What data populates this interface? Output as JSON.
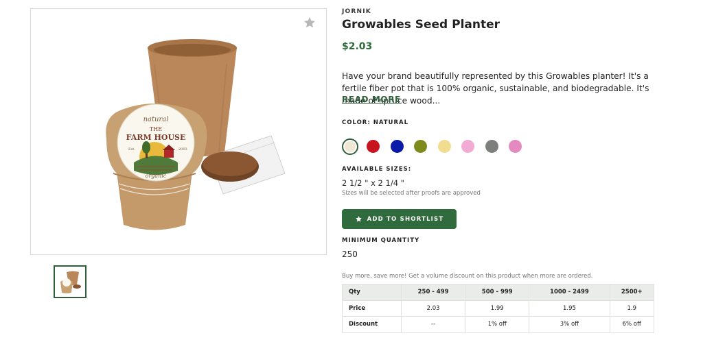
{
  "product": {
    "brand": "JORNIK",
    "title": "Growables Seed Planter",
    "price": "$2.03",
    "description": "Have your brand beautifully represented by this Growables planter! It's a fertile fiber pot that is 100% organic, sustainable, and biodegradable. It's made of spruce wood...",
    "read_more": "READ MORE"
  },
  "image": {
    "label_text": [
      "natural",
      "THE",
      "FARM HOUSE",
      "Est.",
      "2003",
      "organic"
    ]
  },
  "colors": {
    "label": "COLOR: NATURAL",
    "swatches": [
      {
        "name": "natural",
        "hex": "#efe7d3",
        "selected": true
      },
      {
        "name": "red",
        "hex": "#c8141f",
        "selected": false
      },
      {
        "name": "blue",
        "hex": "#0b1aa8",
        "selected": false
      },
      {
        "name": "olive",
        "hex": "#7e8a1c",
        "selected": false
      },
      {
        "name": "yellow",
        "hex": "#f1dc8f",
        "selected": false
      },
      {
        "name": "pink",
        "hex": "#f2acd4",
        "selected": false
      },
      {
        "name": "gray",
        "hex": "#7c7f7c",
        "selected": false
      },
      {
        "name": "magenta",
        "hex": "#e48ac0",
        "selected": false
      }
    ]
  },
  "sizes": {
    "label": "AVAILABLE SIZES:",
    "value": "2 1/2 \" x 2 1/4 \"",
    "note": "Sizes will be selected after proofs are approved"
  },
  "shortlist": {
    "label": "ADD TO SHORTLIST",
    "icon": "star-icon"
  },
  "minimum": {
    "label": "MINIMUM QUANTITY",
    "value": "250"
  },
  "pricing": {
    "note": "Buy more, save more! Get a volume discount on this product when more are ordered.",
    "rows": [
      [
        "Qty",
        "250 - 499",
        "500 - 999",
        "1000 - 2499",
        "2500+"
      ],
      [
        "Price",
        "2.03",
        "1.99",
        "1.95",
        "1.9"
      ],
      [
        "Discount",
        "--",
        "1% off",
        "3% off",
        "6% off"
      ]
    ]
  },
  "accent_color": "#2f6b3c"
}
